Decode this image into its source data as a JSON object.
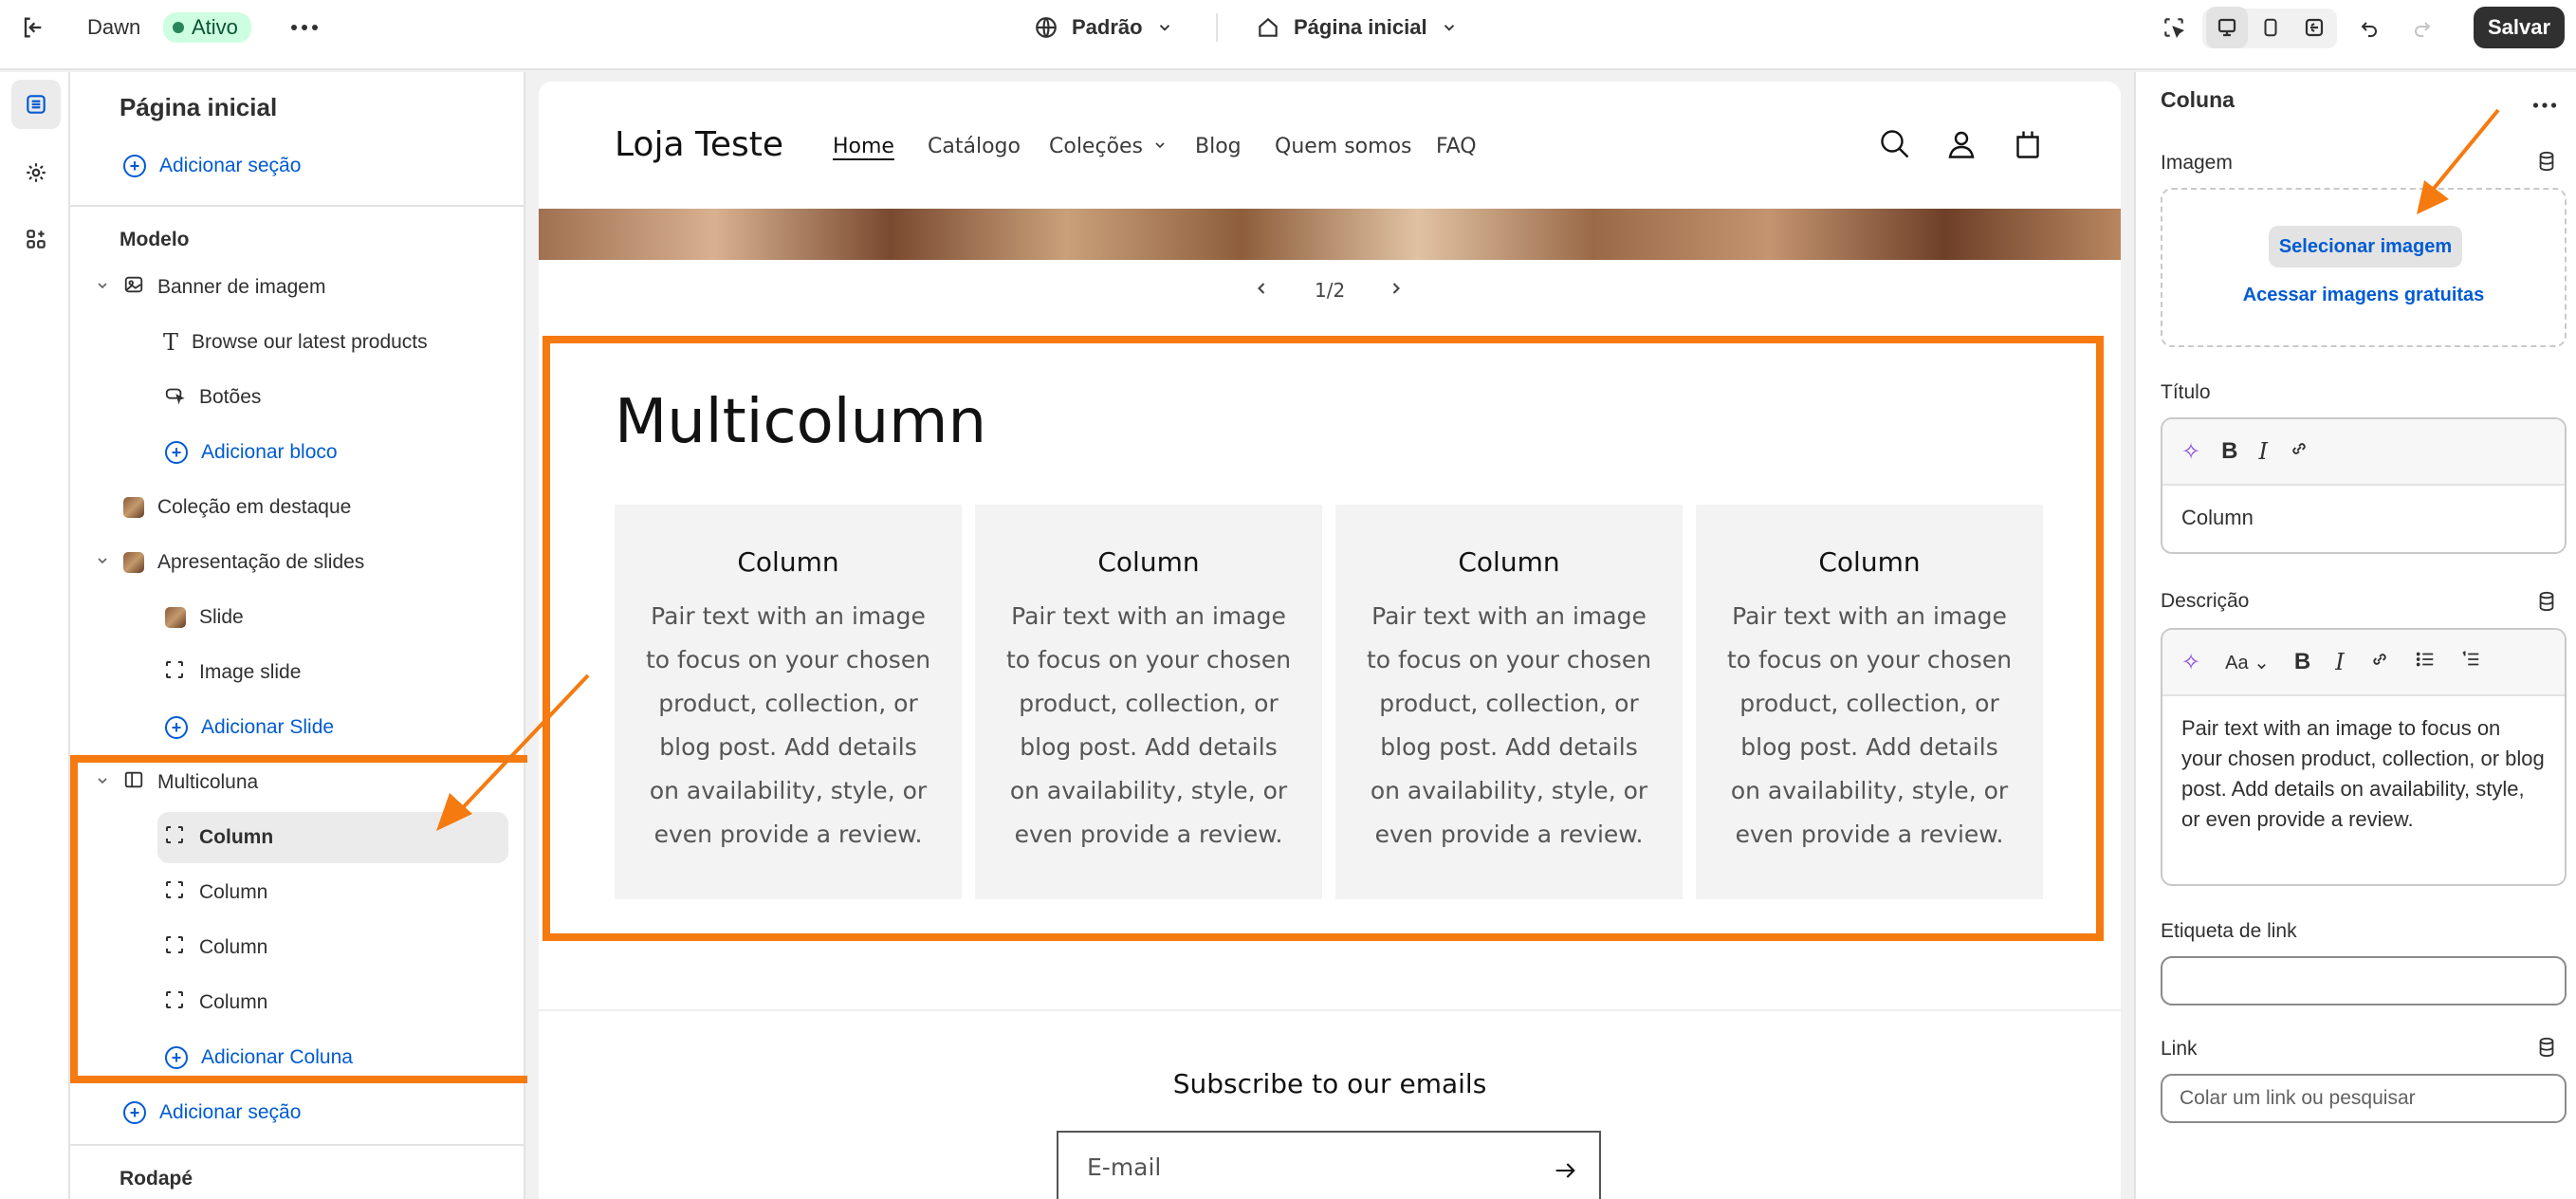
{
  "topbar": {
    "theme_name": "Dawn",
    "status_badge": "Ativo",
    "template_selector": "Padrão",
    "page_selector": "Página inicial",
    "save_label": "Salvar"
  },
  "sidebar": {
    "title": "Página inicial",
    "add_section_top": "Adicionar seção",
    "template_heading": "Modelo",
    "items": [
      {
        "label": "Banner de imagem",
        "kind": "section"
      },
      {
        "label": "Browse our latest products",
        "kind": "block"
      },
      {
        "label": "Botões",
        "kind": "block"
      },
      {
        "label": "Adicionar bloco",
        "kind": "add"
      },
      {
        "label": "Coleção em destaque",
        "kind": "section"
      },
      {
        "label": "Apresentação de slides",
        "kind": "section"
      },
      {
        "label": "Slide",
        "kind": "block"
      },
      {
        "label": "Image slide",
        "kind": "block"
      },
      {
        "label": "Adicionar Slide",
        "kind": "add"
      },
      {
        "label": "Multicoluna",
        "kind": "section"
      },
      {
        "label": "Column",
        "kind": "block",
        "selected": true
      },
      {
        "label": "Column",
        "kind": "block"
      },
      {
        "label": "Column",
        "kind": "block"
      },
      {
        "label": "Column",
        "kind": "block"
      },
      {
        "label": "Adicionar Coluna",
        "kind": "add"
      }
    ],
    "add_section_bottom": "Adicionar seção",
    "footer_heading": "Rodapé"
  },
  "preview": {
    "store_name": "Loja Teste",
    "nav": [
      "Home",
      "Catálogo",
      "Coleções",
      "Blog",
      "Quem somos",
      "FAQ"
    ],
    "slide_counter": "1/2",
    "multicolumn_title": "Multicolumn",
    "columns": [
      {
        "title": "Column",
        "text": "Pair text with an image to focus on your chosen product, collection, or blog post. Add details on availability, style, or even provide a review."
      },
      {
        "title": "Column",
        "text": "Pair text with an image to focus on your chosen product, collection, or blog post. Add details on availability, style, or even provide a review."
      },
      {
        "title": "Column",
        "text": "Pair text with an image to focus on your chosen product, collection, or blog post. Add details on availability, style, or even provide a review."
      },
      {
        "title": "Column",
        "text": "Pair text with an image to focus on your chosen product, collection, or blog post. Add details on availability, style, or even provide a review."
      }
    ],
    "subscribe_title": "Subscribe to our emails",
    "email_placeholder": "E-mail"
  },
  "panel": {
    "title": "Coluna",
    "image_label": "Imagem",
    "select_image": "Selecionar imagem",
    "free_images": "Acessar imagens gratuitas",
    "title_label": "Título",
    "title_value": "Column",
    "description_label": "Descrição",
    "description_value": "Pair text with an image to focus on your chosen product, collection, or blog post. Add details on availability, style, or even provide a review.",
    "link_label_label": "Etiqueta de link",
    "link_label_value": "",
    "link_label": "Link",
    "link_placeholder": "Colar um link ou pesquisar"
  },
  "colors": {
    "highlight": "#f57a0f",
    "link": "#005bd3",
    "badge_bg": "#cdfee1"
  }
}
